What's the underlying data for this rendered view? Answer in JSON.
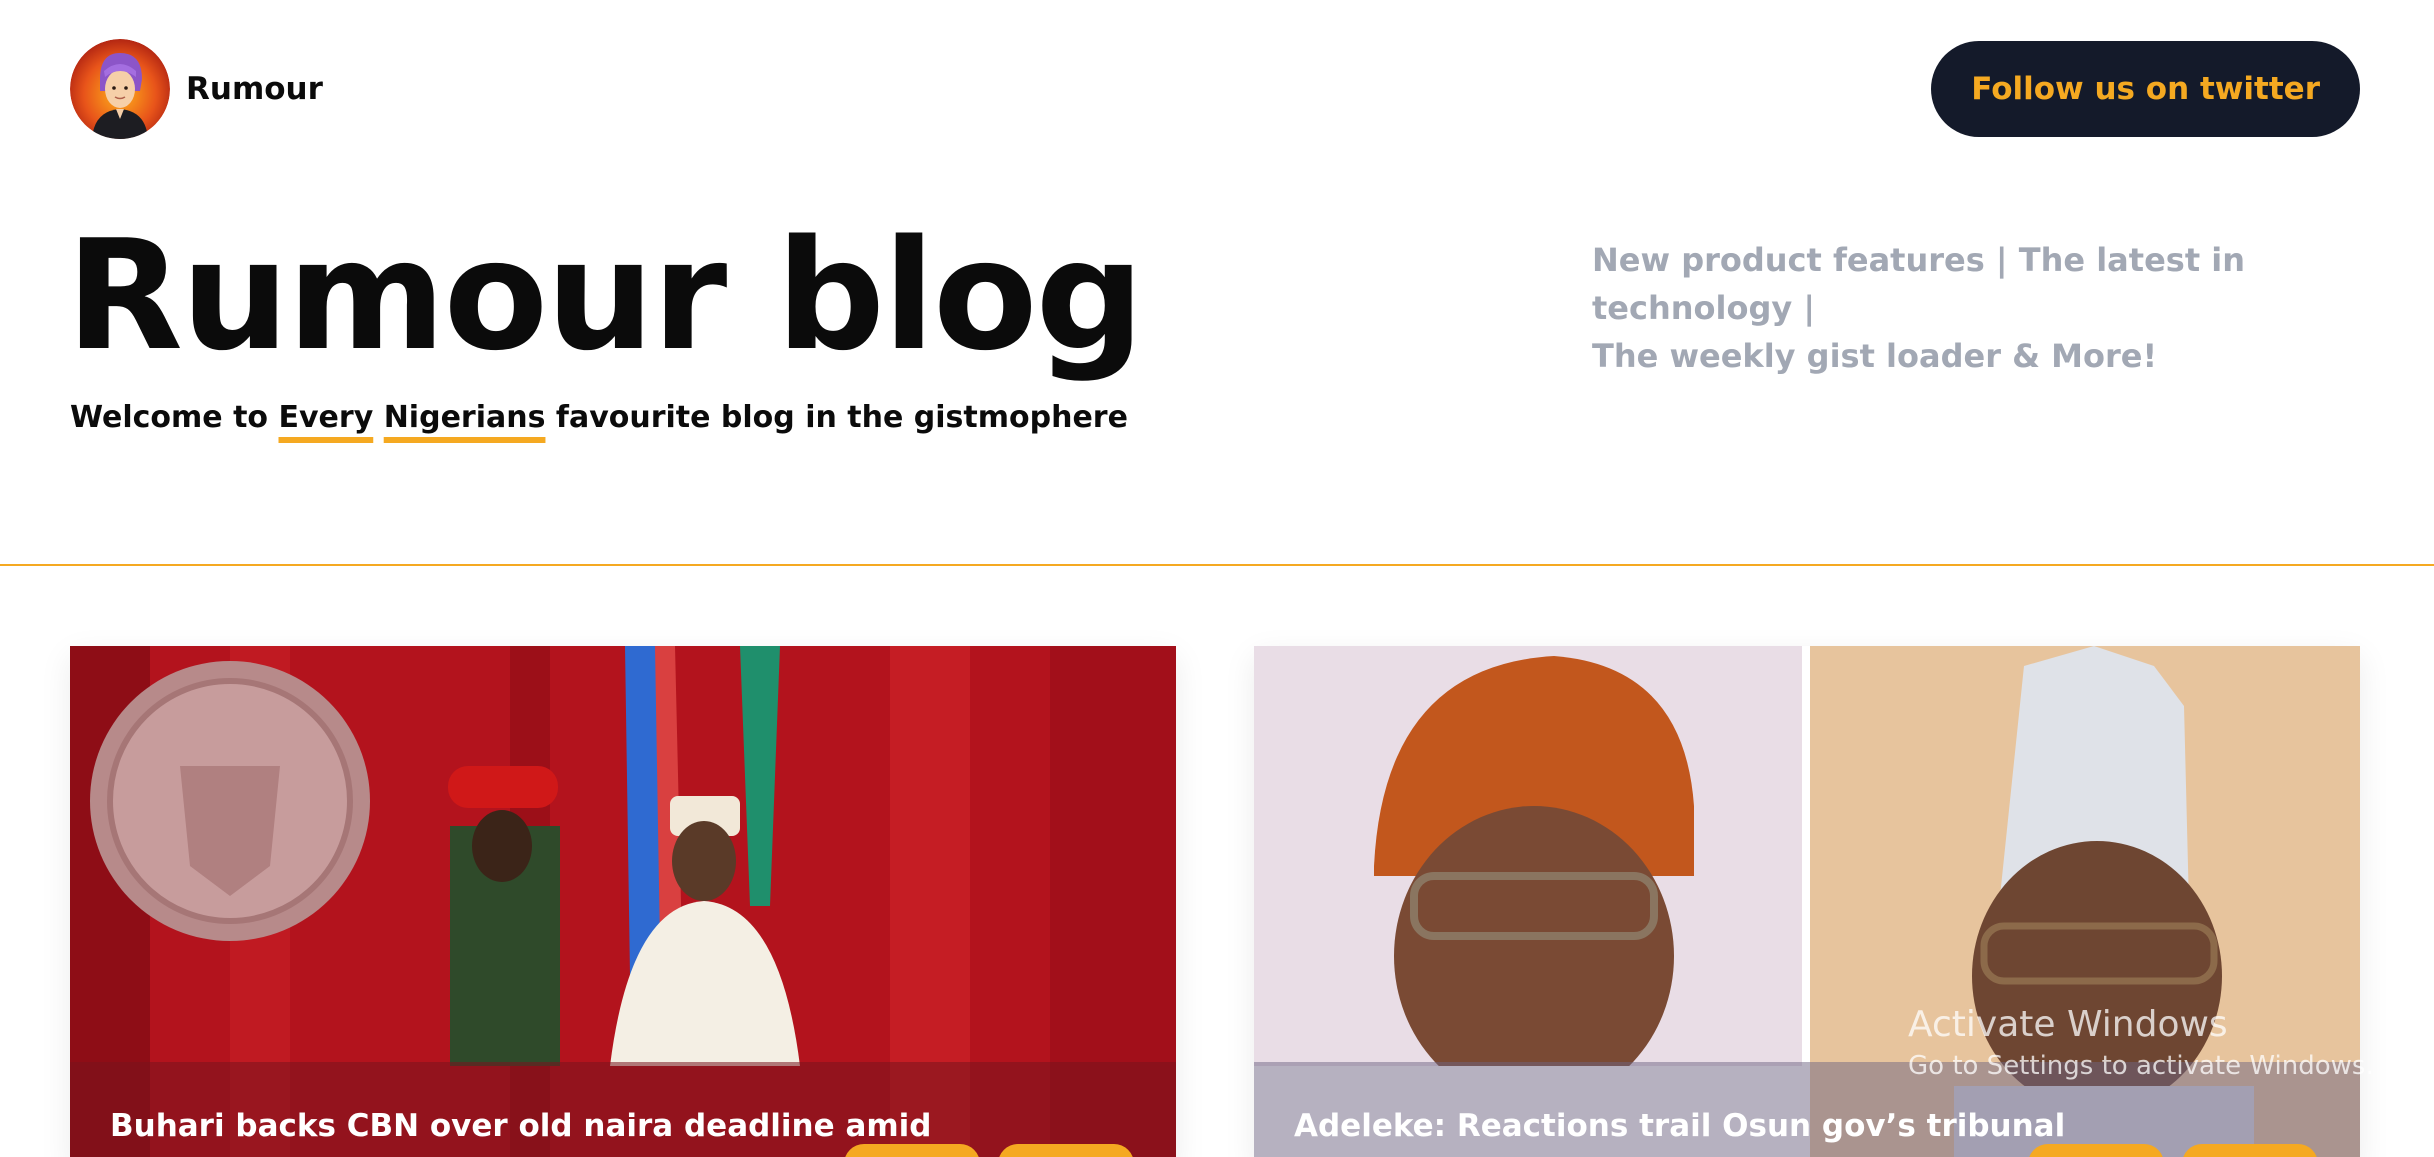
{
  "header": {
    "brand_name": "Rumour",
    "avatar_icon": "memoji-avatar-icon",
    "twitter_button": "Follow us on twitter"
  },
  "hero": {
    "title": "Rumour blog",
    "tagline_start": "Welcome to ",
    "tagline_word1": "Every",
    "tagline_word2": "Nigerians",
    "tagline_end": " favourite blog in the gistmophere",
    "topics_line1": "New product features | The latest in technology |",
    "topics_line2": "The weekly gist loader & More!"
  },
  "cards": [
    {
      "title": "Buhari backs CBN over old naira deadline amid"
    },
    {
      "title": "Adeleke: Reactions trail Osun gov’s tribunal"
    }
  ],
  "watermark": {
    "title": "Activate Windows",
    "subtitle": "Go to Settings to activate Windows."
  },
  "colors": {
    "accent": "#f5a921",
    "button_bg": "#141a2a",
    "muted_text": "#a2a8b4"
  }
}
